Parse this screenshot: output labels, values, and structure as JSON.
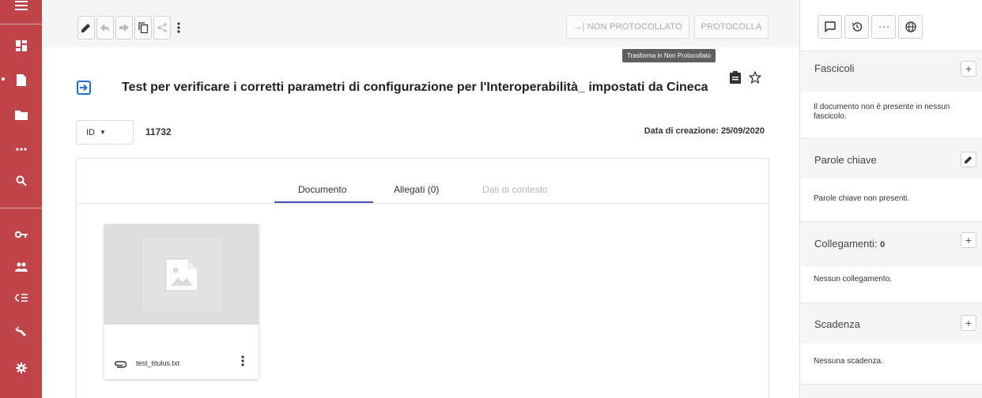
{
  "rail": {
    "color": "#c0454a",
    "icons": [
      "menu-icon",
      "dashboard-icon",
      "document-icon",
      "folder-icon",
      "more-horizontal-icon",
      "search-icon",
      "key-icon",
      "people-icon",
      "list-icon",
      "wrench-icon",
      "settings-icon"
    ]
  },
  "toolbar": {
    "icons": [
      "pencil-icon",
      "reply-icon",
      "forward-icon",
      "copy-icon",
      "share-icon",
      "more-vertical-icon"
    ],
    "non_protocollato_label": "→| NON PROTOCOLLATO",
    "protocolla_label": "PROTOCOLLA",
    "tooltip": "Trasforma in Non Protocollato"
  },
  "document": {
    "title": "Test per verificare i corretti parametri di configurazione per l'Interoperabilità_ impostati da Cineca",
    "id_selector": "ID",
    "id_value": "11732",
    "created_label": "Data di creazione:",
    "created_value": "25/09/2020"
  },
  "tabs": [
    {
      "label": "Documento",
      "active": true
    },
    {
      "label": "Allegati (0)",
      "active": false
    },
    {
      "label": "Dati di contesto",
      "active": false,
      "disabled": true
    }
  ],
  "file": {
    "name": "test_titulus.txt"
  },
  "right_panel": {
    "toolbar_icons": [
      "comment-icon",
      "history-icon",
      "more-horizontal-icon",
      "globe-icon"
    ],
    "sections": [
      {
        "title": "Fascicoli",
        "button": "+",
        "body": "Il documento non è presente in nessun fascicolo."
      },
      {
        "title": "Parole chiave",
        "button": "pencil",
        "body": "Parole chiave non presenti."
      },
      {
        "title": "Collegamenti:",
        "count": "0",
        "button": "+",
        "body": "Nessun collegamento."
      },
      {
        "title": "Scadenza",
        "button": "+",
        "body": "Nessuna scadenza."
      }
    ]
  },
  "colors": {
    "accent": "#3f51b5",
    "doc_icon": "#1e6fd0"
  }
}
